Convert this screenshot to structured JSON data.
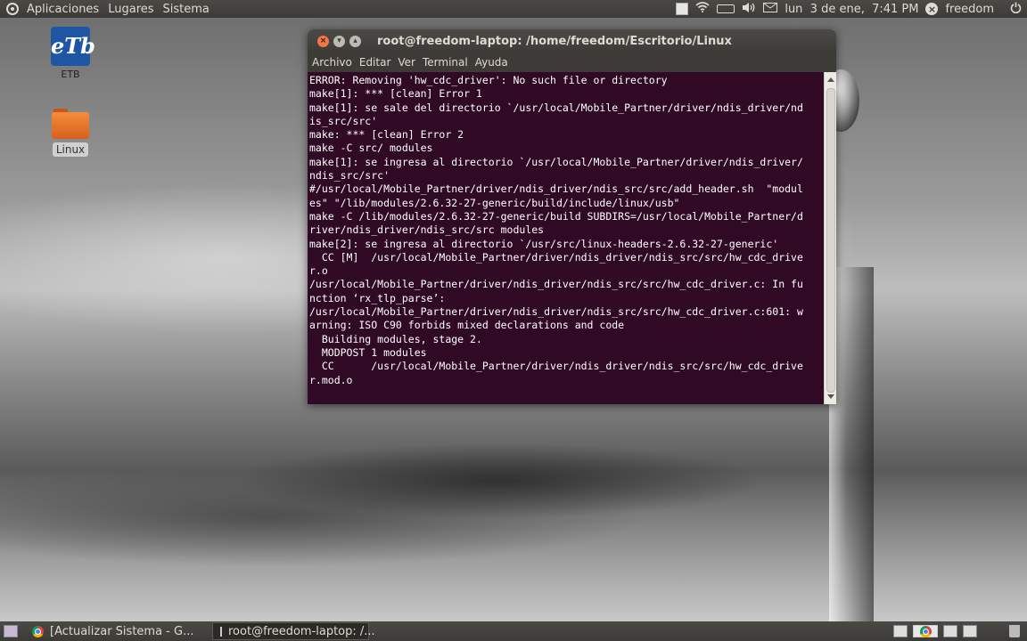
{
  "top_panel": {
    "menus": [
      "Aplicaciones",
      "Lugares",
      "Sistema"
    ],
    "clock": "lun  3 de ene,  7:41 PM",
    "user": "freedom",
    "power_icon": "power-icon"
  },
  "desktop": {
    "icons": [
      {
        "label": "ETB",
        "logo_text": "eTb"
      },
      {
        "label": "Linux"
      }
    ]
  },
  "terminal": {
    "title": "root@freedom-laptop: /home/freedom/Escritorio/Linux",
    "menus": [
      "Archivo",
      "Editar",
      "Ver",
      "Terminal",
      "Ayuda"
    ],
    "lines": [
      "ERROR: Removing 'hw_cdc_driver': No such file or directory",
      "make[1]: *** [clean] Error 1",
      "make[1]: se sale del directorio `/usr/local/Mobile_Partner/driver/ndis_driver/nd",
      "is_src/src'",
      "make: *** [clean] Error 2",
      "make -C src/ modules",
      "make[1]: se ingresa al directorio `/usr/local/Mobile_Partner/driver/ndis_driver/",
      "ndis_src/src'",
      "#/usr/local/Mobile_Partner/driver/ndis_driver/ndis_src/src/add_header.sh  \"modul",
      "es\" \"/lib/modules/2.6.32-27-generic/build/include/linux/usb\"",
      "make -C /lib/modules/2.6.32-27-generic/build SUBDIRS=/usr/local/Mobile_Partner/d",
      "river/ndis_driver/ndis_src/src modules",
      "make[2]: se ingresa al directorio `/usr/src/linux-headers-2.6.32-27-generic'",
      "  CC [M]  /usr/local/Mobile_Partner/driver/ndis_driver/ndis_src/src/hw_cdc_drive",
      "r.o",
      "/usr/local/Mobile_Partner/driver/ndis_driver/ndis_src/src/hw_cdc_driver.c: In fu",
      "nction ‘rx_tlp_parse’:",
      "/usr/local/Mobile_Partner/driver/ndis_driver/ndis_src/src/hw_cdc_driver.c:601: w",
      "arning: ISO C90 forbids mixed declarations and code",
      "  Building modules, stage 2.",
      "  MODPOST 1 modules",
      "  CC      /usr/local/Mobile_Partner/driver/ndis_driver/ndis_src/src/hw_cdc_drive",
      "r.mod.o"
    ]
  },
  "taskbar": {
    "tasks": [
      {
        "label": "[Actualizar Sistema - G...",
        "icon": "chrome-icon"
      },
      {
        "label": "root@freedom-laptop: /...",
        "icon": "terminal-icon"
      }
    ]
  }
}
